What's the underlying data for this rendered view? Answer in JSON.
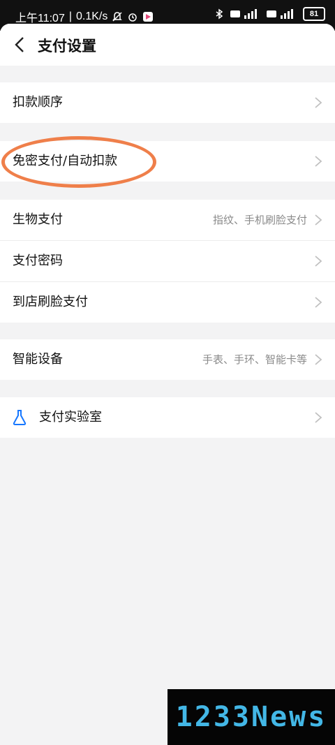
{
  "status_bar": {
    "time": "上午11:07",
    "speed": "0.1K/s",
    "battery": "81"
  },
  "header": {
    "title": "支付设置"
  },
  "groups": [
    {
      "items": [
        {
          "label": "扣款顺序",
          "sub": ""
        }
      ]
    },
    {
      "items": [
        {
          "label": "免密支付/自动扣款",
          "sub": ""
        }
      ]
    },
    {
      "items": [
        {
          "label": "生物支付",
          "sub": "指纹、手机刷脸支付"
        },
        {
          "label": "支付密码",
          "sub": ""
        },
        {
          "label": "到店刷脸支付",
          "sub": ""
        }
      ]
    },
    {
      "items": [
        {
          "label": "智能设备",
          "sub": "手表、手环、智能卡等"
        }
      ]
    },
    {
      "items": [
        {
          "label": "支付实验室",
          "sub": "",
          "icon": "flask-icon"
        }
      ]
    }
  ],
  "watermark": "1233News",
  "colors": {
    "highlight": "#ef7f4a",
    "accent": "#1677ff",
    "watermark": "#43b7e6"
  }
}
